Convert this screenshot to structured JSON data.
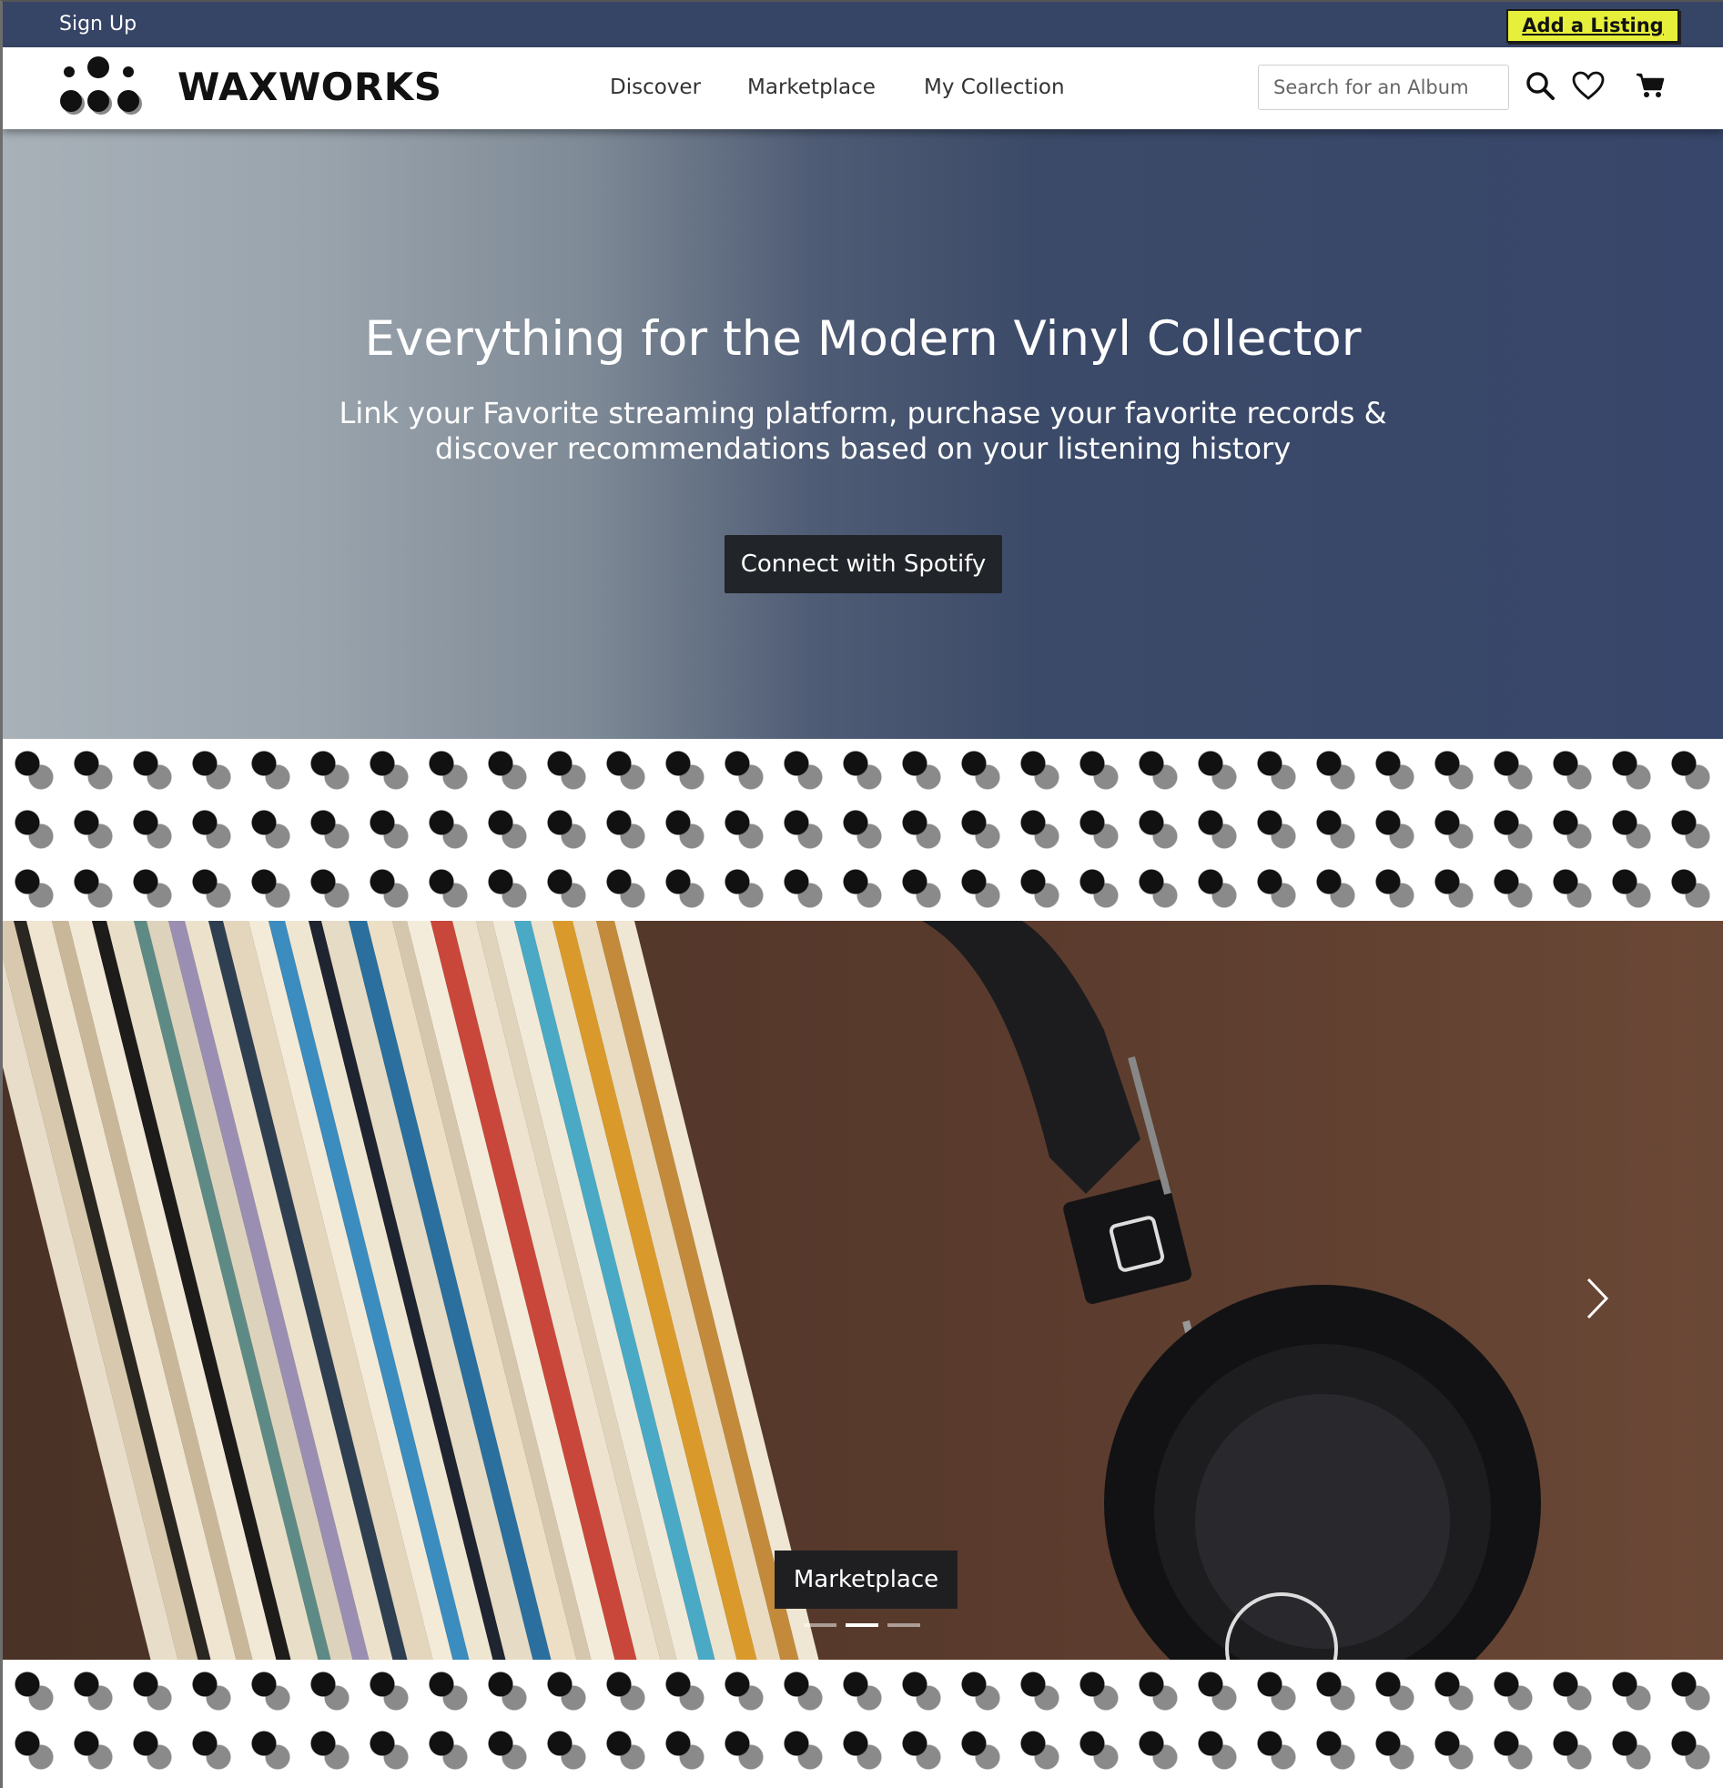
{
  "topbar": {
    "signup_label": "Sign Up",
    "add_listing_label": "Add a Listing"
  },
  "nav": {
    "brand": "WAXWORKS",
    "links": [
      "Discover",
      "Marketplace",
      "My Collection"
    ],
    "search_placeholder": "Search for an Album",
    "icons": [
      "search-icon",
      "heart-icon",
      "cart-icon"
    ]
  },
  "hero": {
    "title": "Everything for the Modern Vinyl Collector",
    "subtitle": "Link your Favorite streaming platform, purchase your favorite records & discover recommendations based on your listening history",
    "button_label": "Connect with Spotify"
  },
  "carousel": {
    "caption": "Marketplace",
    "slide_count": 3,
    "active_slide": 1,
    "icons": [
      "chevron-right-icon"
    ]
  },
  "colors": {
    "topbar": "#364466",
    "accent": "#e6f03a",
    "button_dark": "#212428",
    "hero_left": "#a8b1b8",
    "hero_right": "#37466a"
  }
}
